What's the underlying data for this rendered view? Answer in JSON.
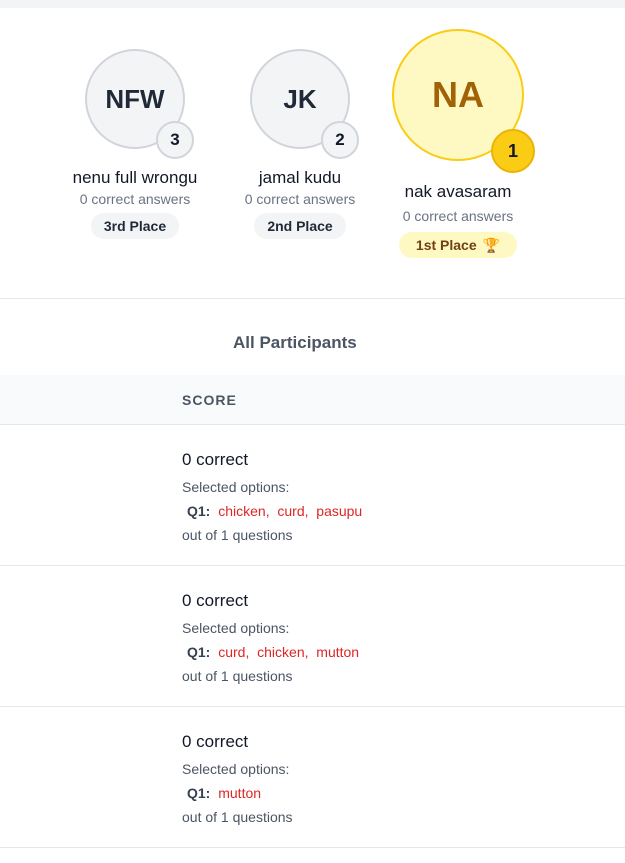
{
  "podium": [
    {
      "initials": "NFW",
      "rank": "3",
      "name": "nenu full wrongu",
      "correct": "0 correct answers",
      "place": "3rd Place"
    },
    {
      "initials": "JK",
      "rank": "2",
      "name": "jamal kudu",
      "correct": "0 correct answers",
      "place": "2nd Place"
    },
    {
      "initials": "NA",
      "rank": "1",
      "name": "nak avasaram",
      "correct": "0 correct answers",
      "place": "1st Place",
      "trophy": "🏆"
    }
  ],
  "participants": {
    "title": "All Participants",
    "score_header": "SCORE",
    "rows": [
      {
        "correct": "0 correct",
        "selected_label": "Selected options:",
        "question": "Q1:",
        "options": [
          "chicken,",
          "curd,",
          "pasupu"
        ],
        "out_of": "out of 1 questions"
      },
      {
        "correct": "0 correct",
        "selected_label": "Selected options:",
        "question": "Q1:",
        "options": [
          "curd,",
          "chicken,",
          "mutton"
        ],
        "out_of": "out of 1 questions"
      },
      {
        "correct": "0 correct",
        "selected_label": "Selected options:",
        "question": "Q1:",
        "options": [
          "mutton"
        ],
        "out_of": "out of 1 questions"
      }
    ]
  },
  "colors": {
    "gold": "#facc15",
    "gold_bg": "#fef9c3",
    "option_red": "#dc2626",
    "muted": "#6b7280"
  }
}
